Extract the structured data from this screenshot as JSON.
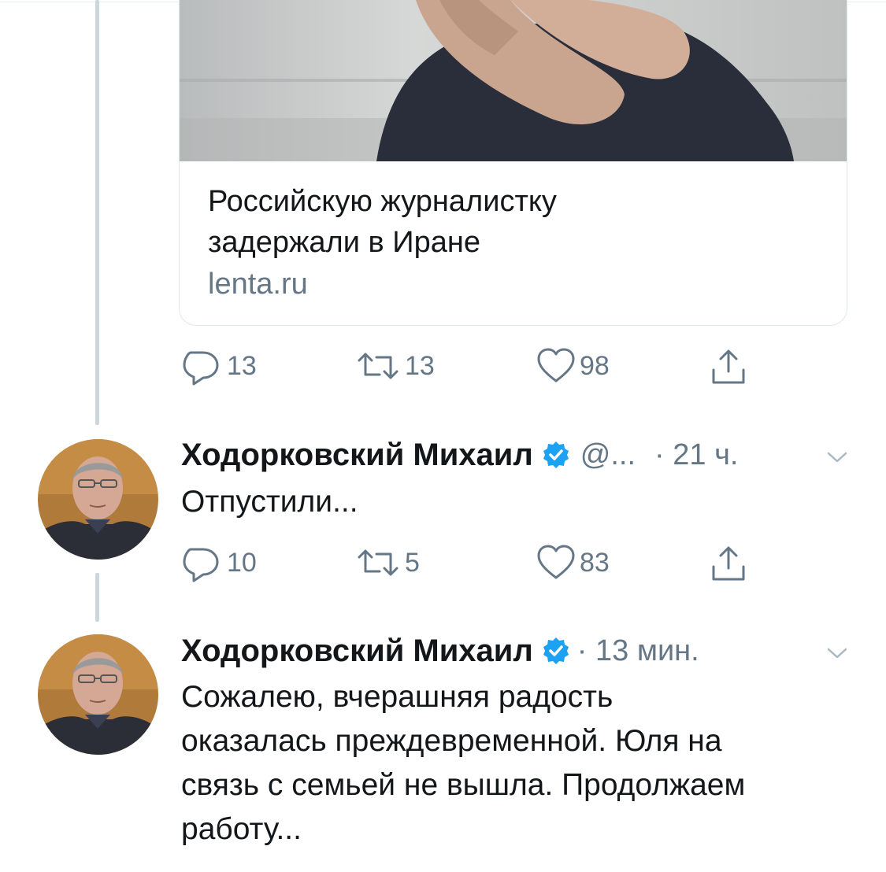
{
  "link_card": {
    "title_line1": "Российскую журналистку",
    "title_line2": "задержали в Иране",
    "domain": "lenta.ru"
  },
  "tweet1_actions": {
    "replies": "13",
    "retweets": "13",
    "likes": "98"
  },
  "tweet2": {
    "name": "Ходорковский Михаил",
    "handle": "@...",
    "time": "· 21 ч.",
    "text": "Отпустили...",
    "replies": "10",
    "retweets": "5",
    "likes": "83"
  },
  "tweet3": {
    "name": "Ходорковский Михаил",
    "time": "· 13 мин.",
    "text_line1": "Сожалею, вчерашняя радость",
    "text_line2": "оказалась преждевременной. Юля на",
    "text_line3": "связь с семьей не вышла. Продолжаем",
    "text_line4": "работу..."
  },
  "icons": [
    "reply-icon",
    "retweet-icon",
    "like-icon",
    "share-icon",
    "verified-badge-icon",
    "chevron-down-icon"
  ],
  "colors": {
    "text": "#14171a",
    "secondary": "#657786",
    "verified": "#1da1f2",
    "thread_line": "#ccd6dd"
  }
}
